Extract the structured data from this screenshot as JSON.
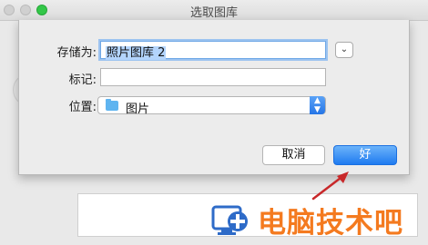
{
  "window": {
    "title": "选取图库"
  },
  "dialog": {
    "save_as_label": "存储为:",
    "save_as_value": "照片图库 2",
    "tags_label": "标记:",
    "tags_value": "",
    "location_label": "位置:",
    "location_value": "图片",
    "cancel_label": "取消",
    "ok_label": "好"
  },
  "watermark": {
    "text": "电脑技术吧"
  },
  "colors": {
    "accent": "#2a7ff0",
    "annotation_arrow": "#c8282a",
    "watermark": "#f47a1f"
  },
  "icons": {
    "expand": "chevron-down-icon",
    "location": "folder-icon",
    "popup": "up-down-arrows-icon"
  }
}
